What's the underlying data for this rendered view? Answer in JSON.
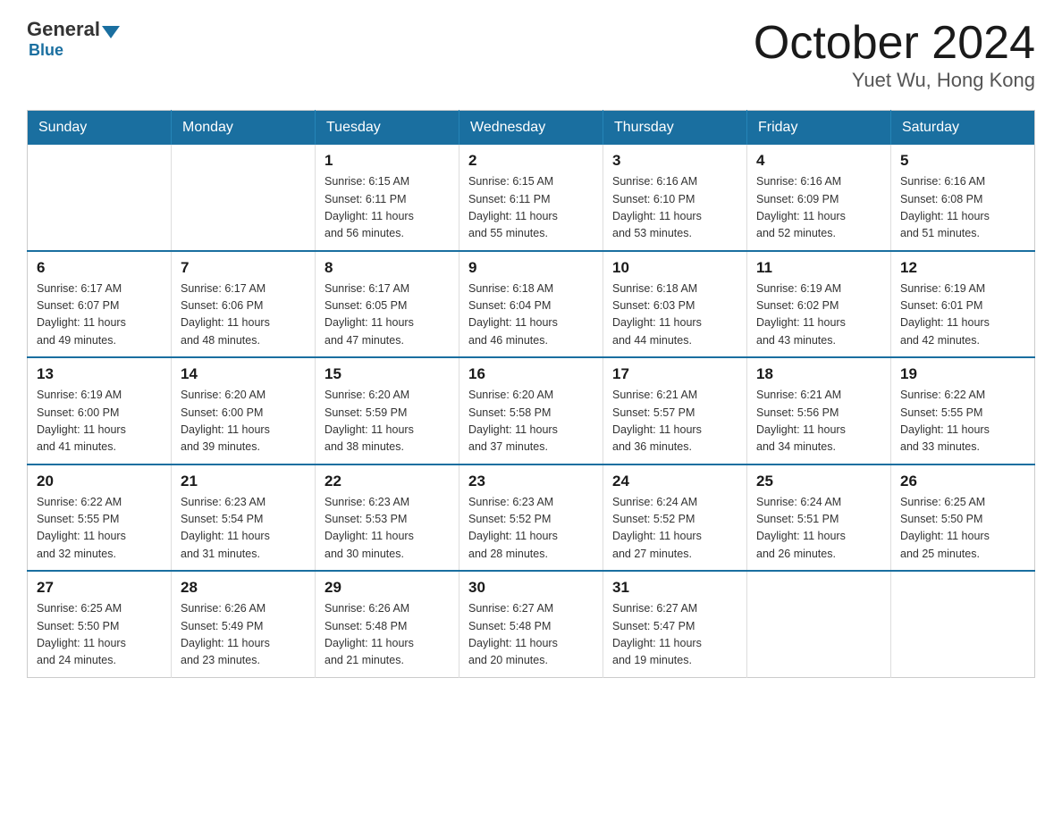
{
  "header": {
    "logo_general": "General",
    "logo_blue": "Blue",
    "month_title": "October 2024",
    "location": "Yuet Wu, Hong Kong"
  },
  "weekdays": [
    "Sunday",
    "Monday",
    "Tuesday",
    "Wednesday",
    "Thursday",
    "Friday",
    "Saturday"
  ],
  "weeks": [
    [
      {
        "day": "",
        "info": ""
      },
      {
        "day": "",
        "info": ""
      },
      {
        "day": "1",
        "info": "Sunrise: 6:15 AM\nSunset: 6:11 PM\nDaylight: 11 hours\nand 56 minutes."
      },
      {
        "day": "2",
        "info": "Sunrise: 6:15 AM\nSunset: 6:11 PM\nDaylight: 11 hours\nand 55 minutes."
      },
      {
        "day": "3",
        "info": "Sunrise: 6:16 AM\nSunset: 6:10 PM\nDaylight: 11 hours\nand 53 minutes."
      },
      {
        "day": "4",
        "info": "Sunrise: 6:16 AM\nSunset: 6:09 PM\nDaylight: 11 hours\nand 52 minutes."
      },
      {
        "day": "5",
        "info": "Sunrise: 6:16 AM\nSunset: 6:08 PM\nDaylight: 11 hours\nand 51 minutes."
      }
    ],
    [
      {
        "day": "6",
        "info": "Sunrise: 6:17 AM\nSunset: 6:07 PM\nDaylight: 11 hours\nand 49 minutes."
      },
      {
        "day": "7",
        "info": "Sunrise: 6:17 AM\nSunset: 6:06 PM\nDaylight: 11 hours\nand 48 minutes."
      },
      {
        "day": "8",
        "info": "Sunrise: 6:17 AM\nSunset: 6:05 PM\nDaylight: 11 hours\nand 47 minutes."
      },
      {
        "day": "9",
        "info": "Sunrise: 6:18 AM\nSunset: 6:04 PM\nDaylight: 11 hours\nand 46 minutes."
      },
      {
        "day": "10",
        "info": "Sunrise: 6:18 AM\nSunset: 6:03 PM\nDaylight: 11 hours\nand 44 minutes."
      },
      {
        "day": "11",
        "info": "Sunrise: 6:19 AM\nSunset: 6:02 PM\nDaylight: 11 hours\nand 43 minutes."
      },
      {
        "day": "12",
        "info": "Sunrise: 6:19 AM\nSunset: 6:01 PM\nDaylight: 11 hours\nand 42 minutes."
      }
    ],
    [
      {
        "day": "13",
        "info": "Sunrise: 6:19 AM\nSunset: 6:00 PM\nDaylight: 11 hours\nand 41 minutes."
      },
      {
        "day": "14",
        "info": "Sunrise: 6:20 AM\nSunset: 6:00 PM\nDaylight: 11 hours\nand 39 minutes."
      },
      {
        "day": "15",
        "info": "Sunrise: 6:20 AM\nSunset: 5:59 PM\nDaylight: 11 hours\nand 38 minutes."
      },
      {
        "day": "16",
        "info": "Sunrise: 6:20 AM\nSunset: 5:58 PM\nDaylight: 11 hours\nand 37 minutes."
      },
      {
        "day": "17",
        "info": "Sunrise: 6:21 AM\nSunset: 5:57 PM\nDaylight: 11 hours\nand 36 minutes."
      },
      {
        "day": "18",
        "info": "Sunrise: 6:21 AM\nSunset: 5:56 PM\nDaylight: 11 hours\nand 34 minutes."
      },
      {
        "day": "19",
        "info": "Sunrise: 6:22 AM\nSunset: 5:55 PM\nDaylight: 11 hours\nand 33 minutes."
      }
    ],
    [
      {
        "day": "20",
        "info": "Sunrise: 6:22 AM\nSunset: 5:55 PM\nDaylight: 11 hours\nand 32 minutes."
      },
      {
        "day": "21",
        "info": "Sunrise: 6:23 AM\nSunset: 5:54 PM\nDaylight: 11 hours\nand 31 minutes."
      },
      {
        "day": "22",
        "info": "Sunrise: 6:23 AM\nSunset: 5:53 PM\nDaylight: 11 hours\nand 30 minutes."
      },
      {
        "day": "23",
        "info": "Sunrise: 6:23 AM\nSunset: 5:52 PM\nDaylight: 11 hours\nand 28 minutes."
      },
      {
        "day": "24",
        "info": "Sunrise: 6:24 AM\nSunset: 5:52 PM\nDaylight: 11 hours\nand 27 minutes."
      },
      {
        "day": "25",
        "info": "Sunrise: 6:24 AM\nSunset: 5:51 PM\nDaylight: 11 hours\nand 26 minutes."
      },
      {
        "day": "26",
        "info": "Sunrise: 6:25 AM\nSunset: 5:50 PM\nDaylight: 11 hours\nand 25 minutes."
      }
    ],
    [
      {
        "day": "27",
        "info": "Sunrise: 6:25 AM\nSunset: 5:50 PM\nDaylight: 11 hours\nand 24 minutes."
      },
      {
        "day": "28",
        "info": "Sunrise: 6:26 AM\nSunset: 5:49 PM\nDaylight: 11 hours\nand 23 minutes."
      },
      {
        "day": "29",
        "info": "Sunrise: 6:26 AM\nSunset: 5:48 PM\nDaylight: 11 hours\nand 21 minutes."
      },
      {
        "day": "30",
        "info": "Sunrise: 6:27 AM\nSunset: 5:48 PM\nDaylight: 11 hours\nand 20 minutes."
      },
      {
        "day": "31",
        "info": "Sunrise: 6:27 AM\nSunset: 5:47 PM\nDaylight: 11 hours\nand 19 minutes."
      },
      {
        "day": "",
        "info": ""
      },
      {
        "day": "",
        "info": ""
      }
    ]
  ]
}
